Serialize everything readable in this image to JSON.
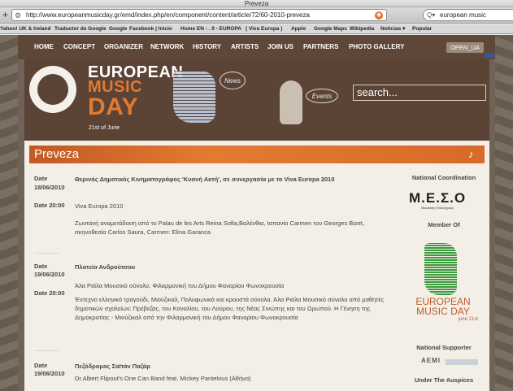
{
  "window": {
    "title": "Preveza"
  },
  "toolbar": {
    "url": "http://www.europeanmusicday.gr/emd/index.php/en/component/content/article/72/60-2010-preveza",
    "search_text": "european music"
  },
  "bookmarks": [
    "Yahoo! UK & Ireland",
    "Traductor de Google",
    "Google",
    "Facebook | Inicio",
    "Home EN - . 9 - EUROPA",
    "( Viva Europa )",
    "Apple",
    "Google Maps",
    "Wikipedia",
    "Noticias ▾",
    "Popular"
  ],
  "nav": {
    "items": [
      "HOME",
      "CONCEPT",
      "ORGANIZER",
      "NETWORK",
      "HISTORY",
      "ARTISTS",
      "JOIN US",
      "PARTNERS",
      "PHOTO GALLERY"
    ],
    "open_ua": "OPEN_UA"
  },
  "header": {
    "title_line1": "EUROPEAN",
    "title_line2": "MUSIC",
    "title_line3": "DAY",
    "subtitle": "21st of June",
    "news": "News",
    "events": "Events",
    "search_placeholder": "search..."
  },
  "colors": {
    "accent": "#e07a32",
    "brand_brown": "#5b4335",
    "green": "#3a9a3c"
  },
  "page_title": "Preveza",
  "events": [
    {
      "date_label": "Date",
      "date": "18/06/2010",
      "title": "Θερινός Δημοτικός Κινηματογράφος 'Κυανή Ακτή', σε συνεργασία με το Viva Europa 2010",
      "time_label": "Date 20:00",
      "venue": "Viva Europa 2010",
      "description": "Ζωντανή αναμετάδοση από το Palau de les Arts Reina Sofia,Βαλένθια, Ισπανία Carmen του Georges Bizet, σκηνοθεσία Carlos Saura, Carmen: Elina Garanca"
    },
    {
      "date_label": "Date",
      "date": "19/06/2010",
      "title": "Πλατεία Ανδρούτσου",
      "time_label": "Date 20:00",
      "venue": "Άλα Ριάλα Μουσικό σύνολο, Φιλαρμονική του Δήμου Φαναρίου Φωνοκρουσία",
      "description": "Έντεχνο ελληνικό τραγούδι, Μιούζικαλ, Πολυφωνικά και κρουστά σύνολα. Άλα Ριάλα Μουσικό σύνολο από μαθητές δημοτικών σχολείων: Πρέβεζας, του Καναλίου, του Λούρου, της Νέας Σινώπης και του Ωρωπού. Η Γένηση της Δημοκρατίας - Μιούζικαλ από την Φιλαρμονική του Δήμου Φαναρίου Φωνοκρουσία"
    },
    {
      "date_label": "Date",
      "date": "19/06/2010",
      "title": "Πεζόδρομος Σαϊτάν Παζάρ",
      "venue": "Dr.Albert Flipout's One Can Band feat. Mickey Pantelous (Αθήνα)"
    }
  ],
  "sidebar": {
    "coordination": "National Coordination",
    "meso_logo": "Μ.Ε.Σ.Ο",
    "meso_small": "Μουσικής Ενδελέχειας",
    "member_of": "Member Of",
    "emd_line1": "EUROPEAN",
    "emd_line2": "MUSIC DAY",
    "emd_date": "june 21st",
    "supporter": "National Supporter",
    "aemi": "AEMI",
    "auspices": "Under The Auspices"
  }
}
